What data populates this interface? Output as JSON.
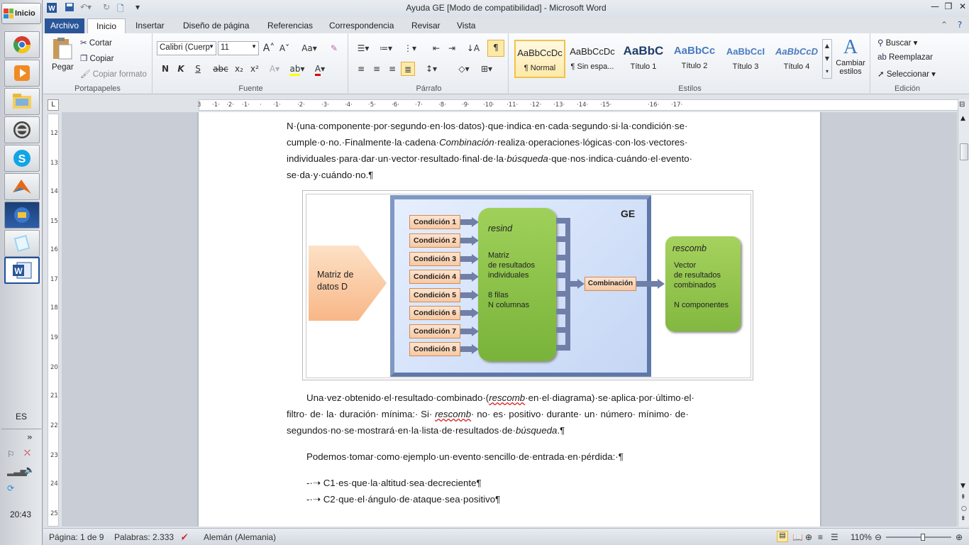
{
  "taskbar": {
    "start_label": "Inicio",
    "language": "ES",
    "clock": "20:43",
    "apps": [
      "chrome-icon",
      "media-player-icon",
      "file-explorer-icon",
      "disk-utility-icon",
      "skype-icon",
      "matlab-icon",
      "windows-media-icon",
      "notepad-icon",
      "word-icon"
    ]
  },
  "window": {
    "title": "Ayuda GE [Modo de compatibilidad]  -  Microsoft Word"
  },
  "tabs": {
    "file": "Archivo",
    "items": [
      "Inicio",
      "Insertar",
      "Diseño de página",
      "Referencias",
      "Correspondencia",
      "Revisar",
      "Vista"
    ]
  },
  "ribbon": {
    "clipboard": {
      "paste": "Pegar",
      "cut": "Cortar",
      "copy": "Copiar",
      "format_painter": "Copiar formato",
      "label": "Portapapeles"
    },
    "font": {
      "name": "Calibri (Cuerp",
      "size": "11",
      "label": "Fuente",
      "bold": "N",
      "italic": "K",
      "underline": "S",
      "strike": "abc"
    },
    "paragraph": {
      "label": "Párrafo"
    },
    "styles": {
      "label": "Estilos",
      "items": [
        {
          "sample": "AaBbCcDc",
          "name": "¶ Normal"
        },
        {
          "sample": "AaBbCcDc",
          "name": "¶ Sin espa..."
        },
        {
          "sample": "AaBbC",
          "name": "Título 1"
        },
        {
          "sample": "AaBbCc",
          "name": "Título 2"
        },
        {
          "sample": "AaBbCcI",
          "name": "Título 3"
        },
        {
          "sample": "AaBbCcD",
          "name": "Título 4"
        }
      ],
      "change": "Cambiar estilos"
    },
    "editing": {
      "label": "Edición",
      "find": "Buscar",
      "replace": "Reemplazar",
      "select": "Seleccionar"
    }
  },
  "document": {
    "p1_line1": "N·(una·componente·por·segundo·en·los·datos)·que·indica·en·cada·segundo·si·la·condición·se·",
    "p1_line2a": "cumple·o·no.·Finalmente·la·cadena·",
    "p1_line2b": "Combinación·",
    "p1_line2c": "realiza·operaciones·lógicas·con·los·vectores·",
    "p1_line3a": "individuales·para·dar·un·vector·resultado·final·de·la·",
    "p1_line3b": "búsqueda",
    "p1_line3c": "·que·nos·indica·cuándo·el·evento·",
    "p1_line4": "se·da·y·cuándo·no.¶",
    "p2_line1a": "Una·vez·obtenido·el·resultado·combinado·(",
    "p2_line1b": "rescomb",
    "p2_line1c": "·en·el·diagrama)·se·aplica·por·último·el·",
    "p2_line2a": "filtro· de· la· duración· mínima:· Si· ",
    "p2_line2b": "rescomb",
    "p2_line2c": "· no· es· positivo· durante· un· número· mínimo· de·",
    "p2_line3a": "segundos·no·se·mostrará·en·la·lista·de·resultados·de·",
    "p2_line3b": "búsqueda",
    "p2_line3c": ".¶",
    "p3": "Podemos·tomar·como·ejemplo·un·evento·sencillo·de·entrada·en·pérdida:·¶",
    "bullet1": "-·➝  C1·es·que·la·altitud·sea·decreciente¶",
    "bullet2": "-·➝  C2·que·el·ángulo·de·ataque·sea·positivo¶"
  },
  "diagram": {
    "ge": "GE",
    "matriz": [
      "Matriz de",
      "datos D"
    ],
    "conditions": [
      "Condición 1",
      "Condición 2",
      "Condición 3",
      "Condición 4",
      "Condición 5",
      "Condición 6",
      "Condición 7",
      "Condición 8"
    ],
    "resind_title": "resind",
    "resind_lines": [
      "Matriz",
      "de resultados",
      "individuales",
      "",
      "8 filas",
      "N columnas"
    ],
    "combinacion": "Combinación",
    "rescomb_title": "rescomb",
    "rescomb_lines": [
      "Vector",
      "de resultados",
      "combinados",
      "",
      "N componentes"
    ]
  },
  "status": {
    "page": "Página: 1 de 9",
    "words": "Palabras: 2.333",
    "language": "Alemán (Alemania)",
    "zoom": "110%",
    "zoom_fraction": 0.57
  }
}
